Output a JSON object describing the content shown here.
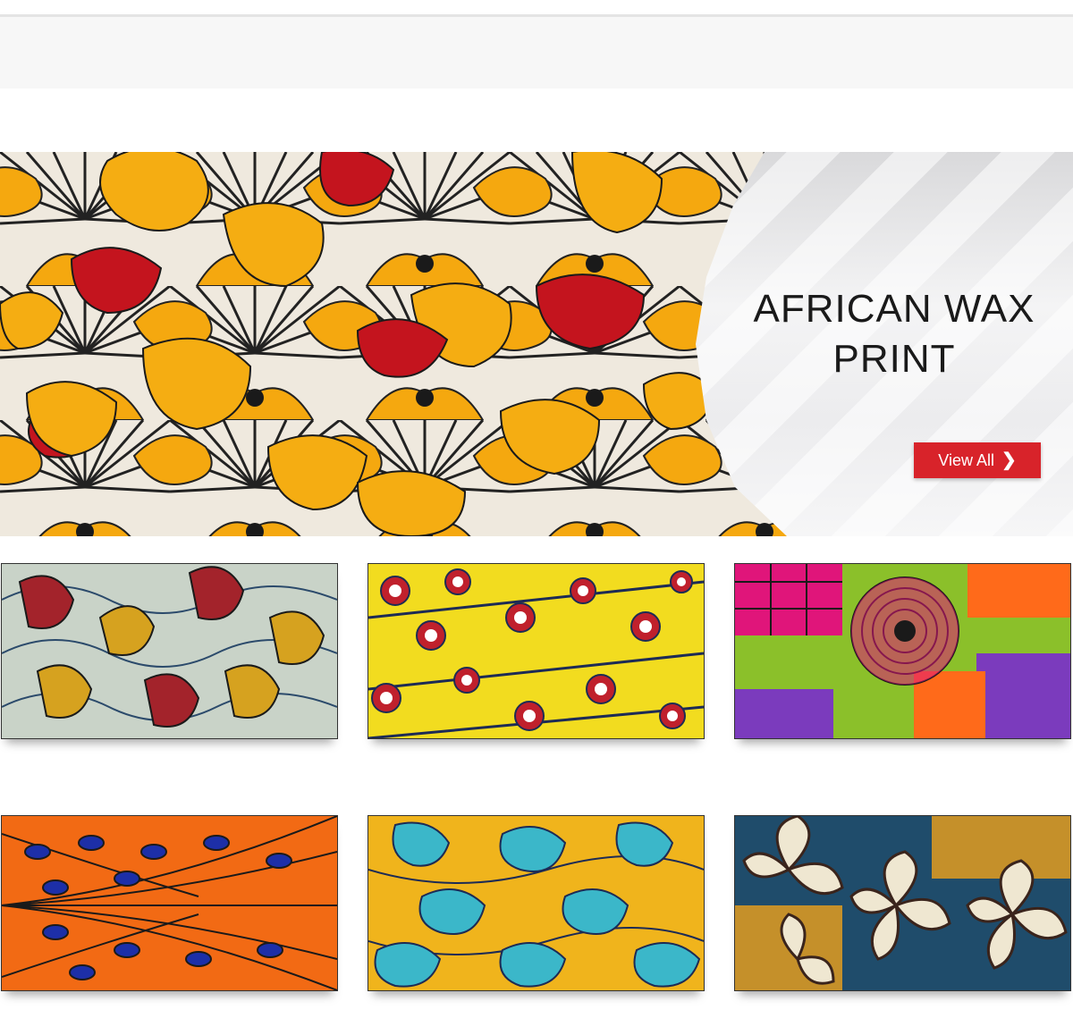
{
  "banner": {
    "title": "AFRICAN WAX PRINT",
    "button_label": "View All",
    "button_color": "#d8232a",
    "button_icon": "chevron-right-icon"
  },
  "products": [
    {
      "pattern": "paisley-swirl",
      "colors": [
        "#c9d3c8",
        "#a3232b",
        "#d6a21f",
        "#2b4a6b"
      ]
    },
    {
      "pattern": "flower-rings",
      "colors": [
        "#f2dc1f",
        "#c0202c",
        "#1d2b55",
        "#ffffff"
      ]
    },
    {
      "pattern": "patchwork-target",
      "colors": [
        "#e0157a",
        "#8bc02a",
        "#7b3bbd",
        "#ff6a1a"
      ]
    },
    {
      "pattern": "peacock-feather",
      "colors": [
        "#f26a14",
        "#1d2fa8",
        "#1a1a1a"
      ]
    },
    {
      "pattern": "blue-coral",
      "colors": [
        "#f0b41c",
        "#3bb7c9",
        "#1d2b55"
      ]
    },
    {
      "pattern": "cream-petals",
      "colors": [
        "#efe7d1",
        "#3a241c",
        "#1f4c6b",
        "#c5902a"
      ]
    }
  ]
}
